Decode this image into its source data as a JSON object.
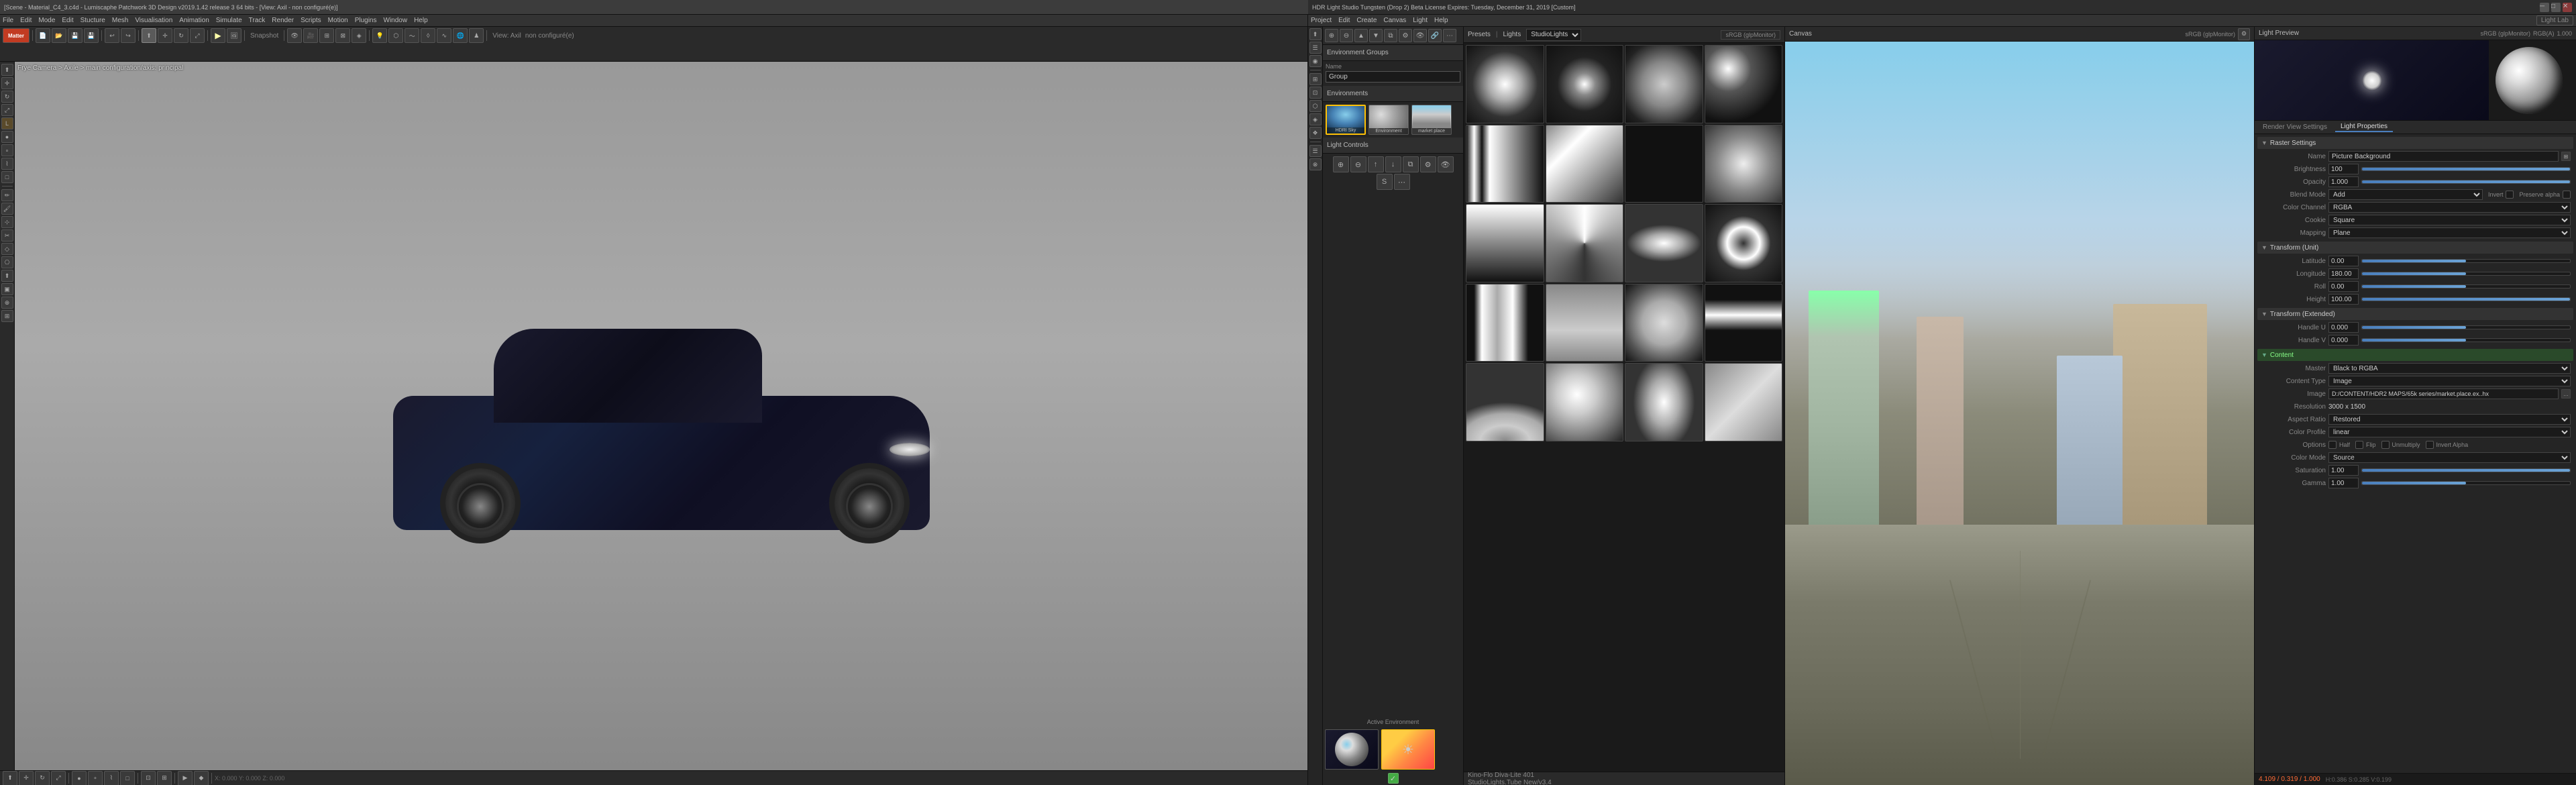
{
  "left_app": {
    "title": "[Scene - Material_C4_3.c4d - Lumiscaphe Patchwork 3D Design v2019.1.42 release 3 64 bits - [View: Axil - non configuré(e)]",
    "menu_items": [
      "File",
      "Edit",
      "Mode",
      "Edit",
      "Stucture",
      "Mesh",
      "Visualisation",
      "Animation",
      "Simulate",
      "Track",
      "Render",
      "Scripts",
      "Motion",
      "Plugins",
      "Window",
      "Help"
    ],
    "viewport_info": "Perspective Camera > Axile: main configuration/axis: principal",
    "camera_label": "Frye Camera > Axile > main configuration/axis: principal",
    "bottom_coords": "0.000 / 0.000 / 0.000"
  },
  "hdr_app": {
    "title": "HDR Light Studio Tungsten (Drop 2) Beta License Expires: Tuesday, December 31, 2019 [Custom]",
    "menu_items": [
      "Project",
      "Edit",
      "Create",
      "Canvas",
      "Light",
      "Help"
    ],
    "toolbar_label": "Light Lab",
    "canvas_label": "Canvas",
    "monitor_label": "sRGB (glpMonitor)",
    "rgb_label": "RGB(A)",
    "value": "1.000"
  },
  "snapshot_label": "Snapshot",
  "environment": {
    "section_label": "Environment Groups",
    "name_label": "Name",
    "name_value": "Group",
    "environments_label": "Environments",
    "thumbnails": [
      {
        "label": "HDRI Sky",
        "type": "sky"
      },
      {
        "label": "Environment",
        "type": "env"
      },
      {
        "label": "market place",
        "type": "market"
      }
    ],
    "add_btn": "Active Environment"
  },
  "light_controls": {
    "title": "Light Controls",
    "icons": [
      "◎",
      "○",
      "⊕",
      "⊗",
      "◉",
      "●",
      "⊙",
      "◈",
      "⊞"
    ]
  },
  "presets": {
    "title": "Presets",
    "lights_label": "Lights",
    "studio_lights_label": "StudioLights",
    "monitor_label": "sRGB (glpMonitor)",
    "footer_line1": "Kino-Flo Diva-Lite 401",
    "footer_line2": "StudioLights.Tube New/v3.4",
    "items": [
      {
        "type": "ring"
      },
      {
        "type": "spot"
      },
      {
        "type": "soft"
      },
      {
        "type": "hard"
      },
      {
        "type": "strip"
      },
      {
        "type": "box"
      },
      {
        "type": "dark"
      },
      {
        "type": "bright"
      },
      {
        "type": "gradient"
      },
      {
        "type": "multi"
      },
      {
        "type": "oval"
      },
      {
        "type": "doughnut"
      },
      {
        "type": "rect_h"
      },
      {
        "type": "panel"
      },
      {
        "type": "octa"
      },
      {
        "type": "strip2"
      },
      {
        "type": "dome"
      },
      {
        "type": "beauty"
      },
      {
        "type": "eye"
      },
      {
        "type": "softbox2"
      }
    ]
  },
  "canvas_panel": {
    "label": "Canvas",
    "monitor": "sRGB (glpMonitor)"
  },
  "light_preview": {
    "label": "Light Preview",
    "monitor": "sRGB (glpMonitor)",
    "rgb": "RGB(A)",
    "value": "1.000"
  },
  "render_settings": {
    "tab1": "Render View Settings",
    "tab2": "Light Properties"
  },
  "light_properties": {
    "section_raster": "Raster Settings",
    "name_label": "Name",
    "name_value": "Picture Background",
    "brightness_label": "Brightness",
    "brightness_value": "100",
    "opacity_label": "Opacity",
    "opacity_value": "1.000",
    "blend_mode_label": "Blend Mode",
    "blend_mode_value": "Add",
    "invert_label": "Invert",
    "preserve_alpha_label": "Preserve alpha",
    "color_channel_label": "Color Channel",
    "color_channel_value": "RGBA",
    "cookie_label": "Cookie",
    "cookie_value": "Square",
    "mapping_label": "Mapping",
    "mapping_value": "Plane",
    "section_transform": "Transform (Unit)",
    "latitude_label": "Latitude",
    "latitude_value": "0.00",
    "longitude_label": "Longitude",
    "longitude_value": "180.00",
    "roll_label": "Roll",
    "roll_value": "0.00",
    "height_label": "Height",
    "height_value": "100.00",
    "section_transform2": "Transform (Extended)",
    "handle_u_label": "Handle U",
    "handle_u_value": "0.000",
    "handle_v_label": "Handle V",
    "handle_v_value": "0.000",
    "section_content": "Content",
    "master_label": "Master",
    "master_value": "Black to RGBA",
    "content_type_label": "Content Type",
    "content_type_value": "Image",
    "image_label": "Image",
    "image_value": "D:/CONTENT/HDR2 MAPS/65k series/market.place.ex..hx",
    "resolution_label": "Resolution",
    "resolution_value": "3000 x 1500",
    "aspect_ratio_label": "Aspect Ratio",
    "aspect_ratio_value": "Restored",
    "color_profile_label": "Color Profile",
    "color_profile_value": "linear",
    "options_label": "Options",
    "half_label": "Half",
    "flip_label": "Flip",
    "unmultiply_label": "Unmultiply",
    "invert_alpha_label": "Invert Alpha",
    "color_mode_label": "Color Mode",
    "color_mode_value": "Source",
    "saturation_label": "Saturation",
    "saturation_value": "1.00",
    "gamma_label": "Gamma",
    "gamma_value": "1.00"
  },
  "status_bar": {
    "c4d_coords": "X: 0.000  Y: 0.000  Z: 0.000",
    "hdr_coords_left": "4.109 / 0.319 / 1.000",
    "hdr_coords_right": "H:0.386 S:0.285 V:0.199"
  }
}
